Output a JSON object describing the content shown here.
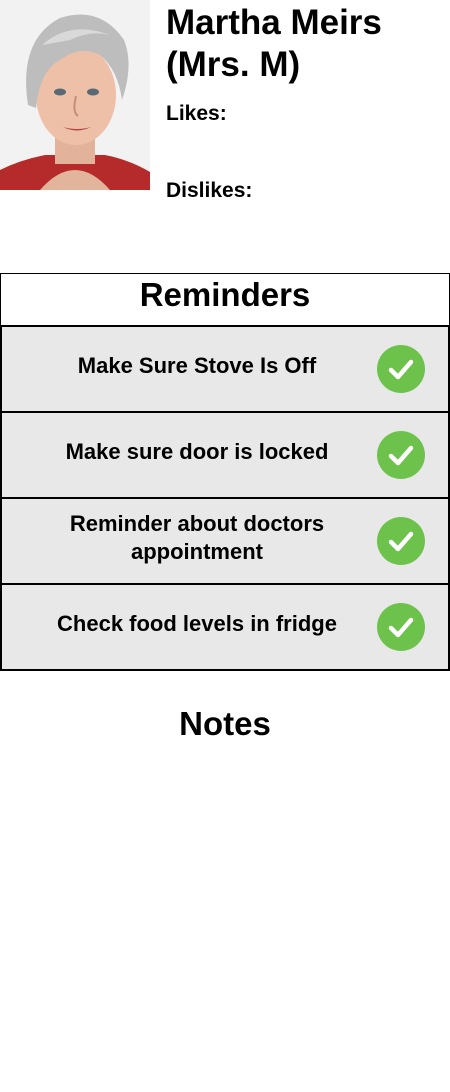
{
  "profile": {
    "name": "Martha Meirs (Mrs. M)",
    "likes_label": "Likes:",
    "dislikes_label": "Dislikes:"
  },
  "reminders": {
    "title": "Reminders",
    "items": [
      {
        "text": "Make Sure Stove Is Off",
        "icon": "check-circle-icon",
        "completed": true
      },
      {
        "text": "Make sure door is locked",
        "icon": "check-circle-icon",
        "completed": true
      },
      {
        "text": "Reminder about doctors appointment",
        "icon": "check-circle-icon",
        "completed": true
      },
      {
        "text": "Check food levels in fridge",
        "icon": "check-circle-icon",
        "completed": true
      }
    ]
  },
  "notes": {
    "title": "Notes"
  },
  "colors": {
    "check_green": "#6cc24a",
    "reminder_background": "#e8e8e8"
  }
}
